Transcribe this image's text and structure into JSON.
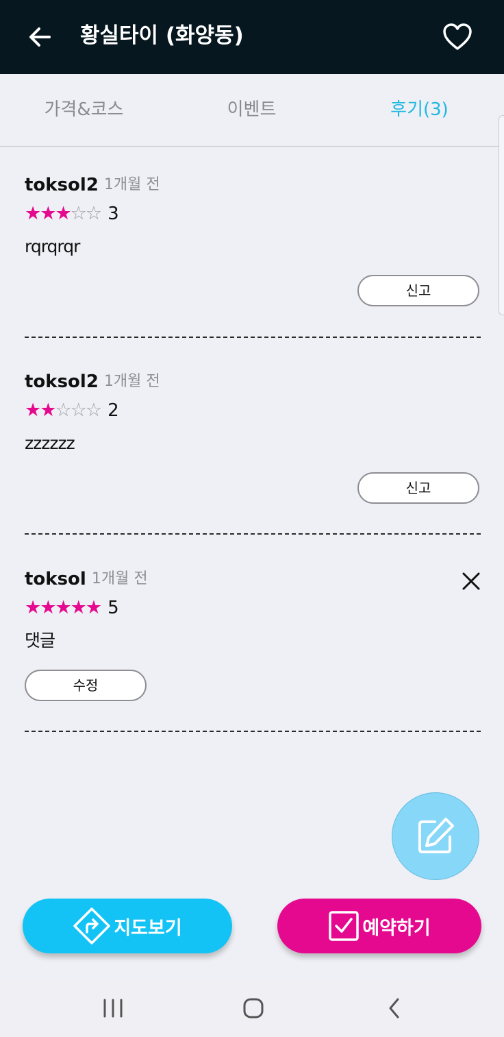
{
  "header": {
    "title": "황실타이 (화양동)",
    "back_icon": "arrow-left-icon",
    "favorite_icon": "heart-outline-icon",
    "background": "#06171f"
  },
  "tabs": [
    {
      "label": "가격&코스",
      "active": false
    },
    {
      "label": "이벤트",
      "active": false
    },
    {
      "label": "후기(3)",
      "active": true
    }
  ],
  "reviews": [
    {
      "author": "toksol2",
      "time": "1개월 전",
      "stars": 3,
      "rating_text": "3",
      "text": "rqrqrqr",
      "action_label": "신고",
      "deletable": false
    },
    {
      "author": "toksol2",
      "time": "1개월 전",
      "stars": 2,
      "rating_text": "2",
      "text": "zzzzzz",
      "action_label": "신고",
      "deletable": false
    },
    {
      "author": "toksol",
      "time": "1개월 전",
      "stars": 5,
      "rating_text": "5",
      "text": "댓글",
      "action_label": "수정",
      "deletable": true
    }
  ],
  "star_glyphs": {
    "filled": "★",
    "empty": "☆"
  },
  "fab": {
    "icon": "edit-icon"
  },
  "buttons": {
    "map_label": "지도보기",
    "reserve_label": "예약하기",
    "map_icon": "direction-sign-icon",
    "reserve_icon": "checkbox-icon"
  },
  "colors": {
    "accent_pink": "#e5098f",
    "accent_blue": "#14c3f5",
    "active_tab": "#1fb8e0",
    "fab": "#86d7f8"
  },
  "navbar": {
    "items": [
      "recent-apps-icon",
      "home-icon",
      "back-icon"
    ]
  }
}
